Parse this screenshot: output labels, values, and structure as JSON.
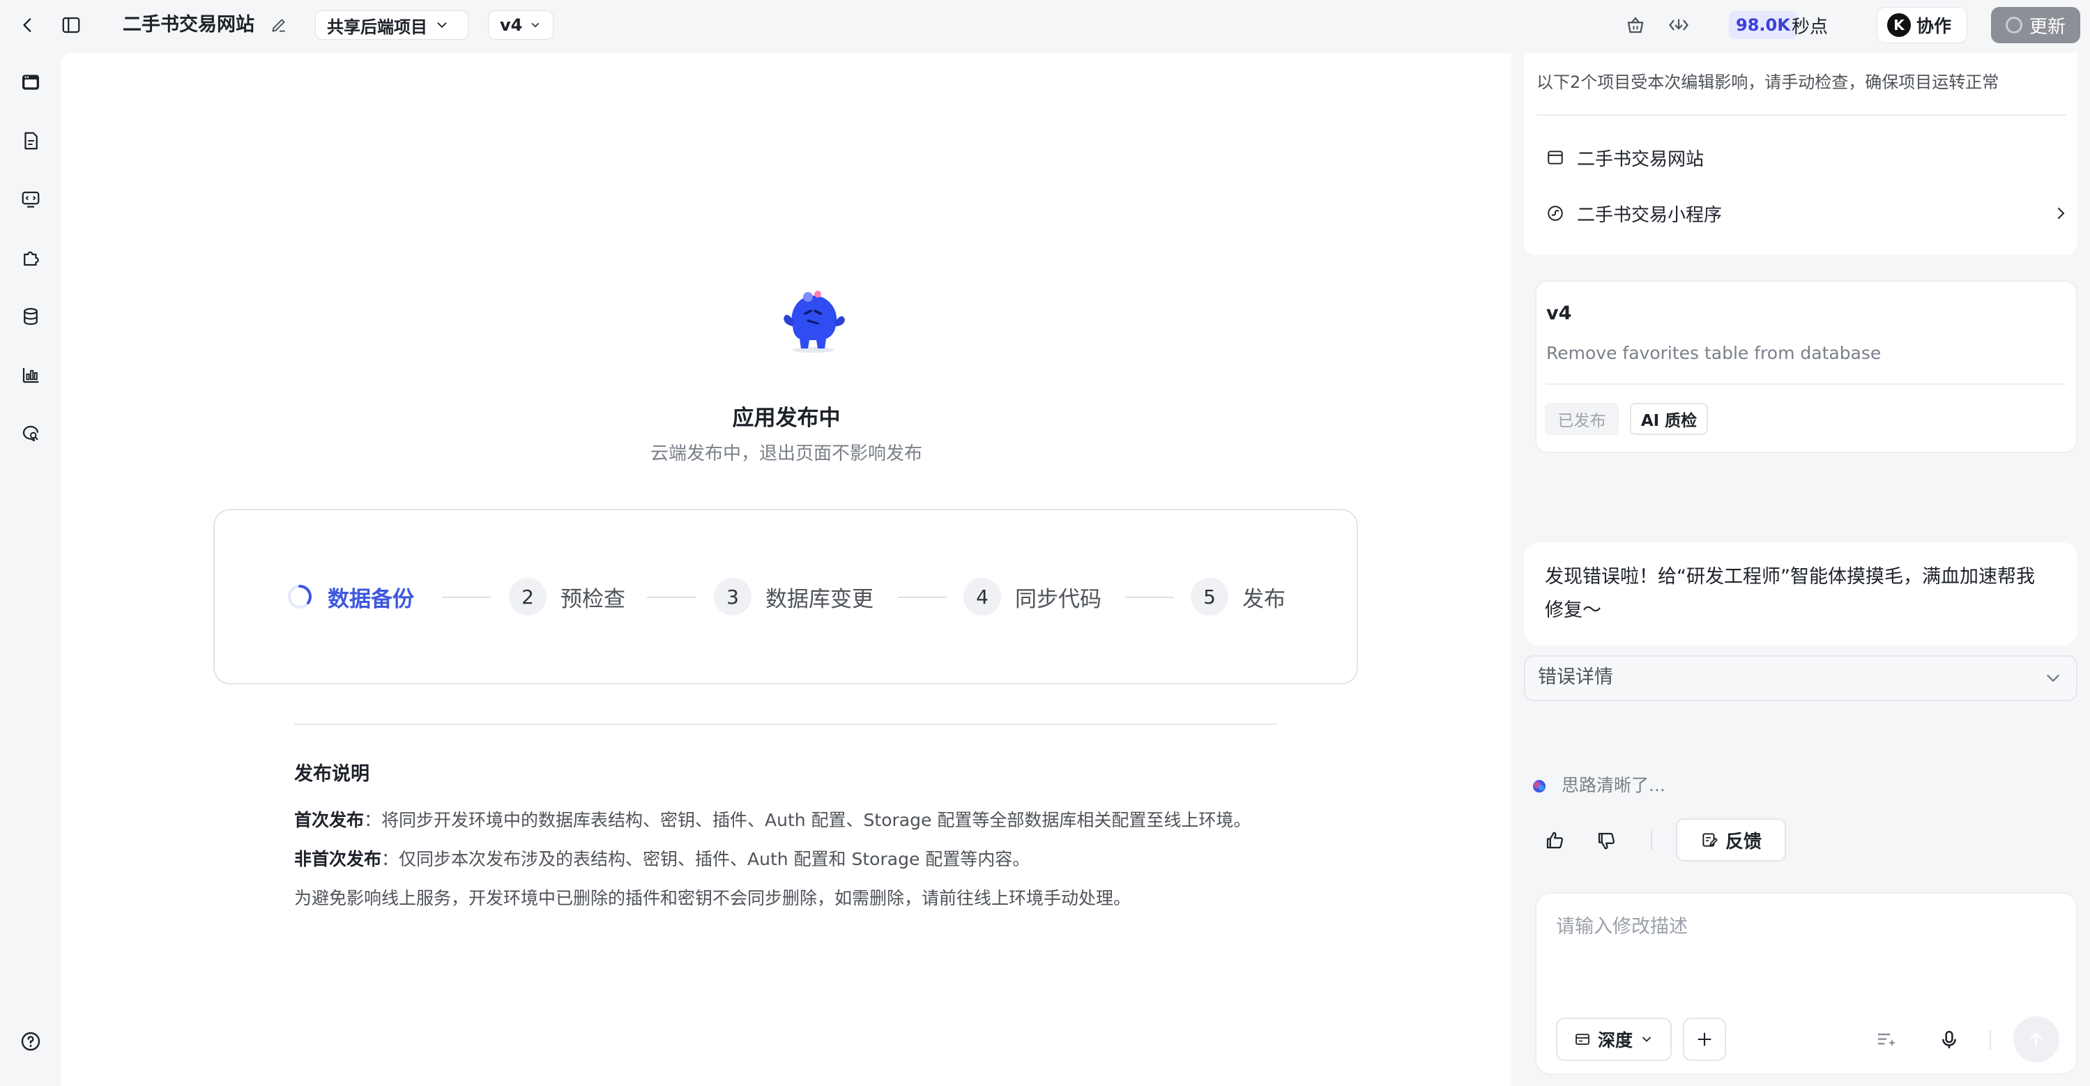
{
  "header": {
    "app_title": "二手书交易网站",
    "backend_project": "共享后端项目",
    "version": "v4",
    "points_value": "98.0K",
    "points_unit": "秒点",
    "collab_avatar": "K",
    "collab_label": "协作",
    "update_label": "更新"
  },
  "deploy": {
    "title": "应用发布中",
    "subtitle": "云端发布中，退出页面不影响发布",
    "steps": [
      {
        "label": "数据备份",
        "state": "active"
      },
      {
        "num": "2",
        "label": "预检查"
      },
      {
        "num": "3",
        "label": "数据库变更"
      },
      {
        "num": "4",
        "label": "同步代码"
      },
      {
        "num": "5",
        "label": "发布"
      }
    ],
    "notes": {
      "title": "发布说明",
      "first_label": "首次发布",
      "first_text": "：将同步开发环境中的数据库表结构、密钥、插件、Auth 配置、Storage 配置等全部数据库相关配置至线上环境。",
      "nonfirst_label": "非首次发布",
      "nonfirst_text": "：仅同步本次发布涉及的表结构、密钥、插件、Auth 配置和 Storage 配置等内容。",
      "warning": "为避免影响线上服务，开发环境中已删除的插件和密钥不会同步删除，如需删除，请前往线上环境手动处理。"
    }
  },
  "right_panel": {
    "affected_notice": "以下2个项目受本次编辑影响，请手动检查，确保项目运转正常",
    "projects": [
      {
        "name": "二手书交易网站",
        "icon": "browser-window-icon"
      },
      {
        "name": "二手书交易小程序",
        "icon": "miniprogram-icon"
      }
    ],
    "version_card": {
      "name": "v4",
      "description": "Remove favorites table from database",
      "tag_published": "已发布",
      "tag_ai_check": "AI 质检"
    },
    "error_message_line1": "发现错误啦！给“研发工程师”智能体摸摸毛，满血加速帮我",
    "error_message_line2": "修复～",
    "error_details_label": "错误详情",
    "thinking_text": "思路清晰了...",
    "feedback_label": "反馈",
    "input_placeholder": "请输入修改描述",
    "depth_label": "深度"
  },
  "colors": {
    "accent": "#3d57e0",
    "points_bg": "#e6e8ff",
    "update_bg": "#8c8f96"
  }
}
